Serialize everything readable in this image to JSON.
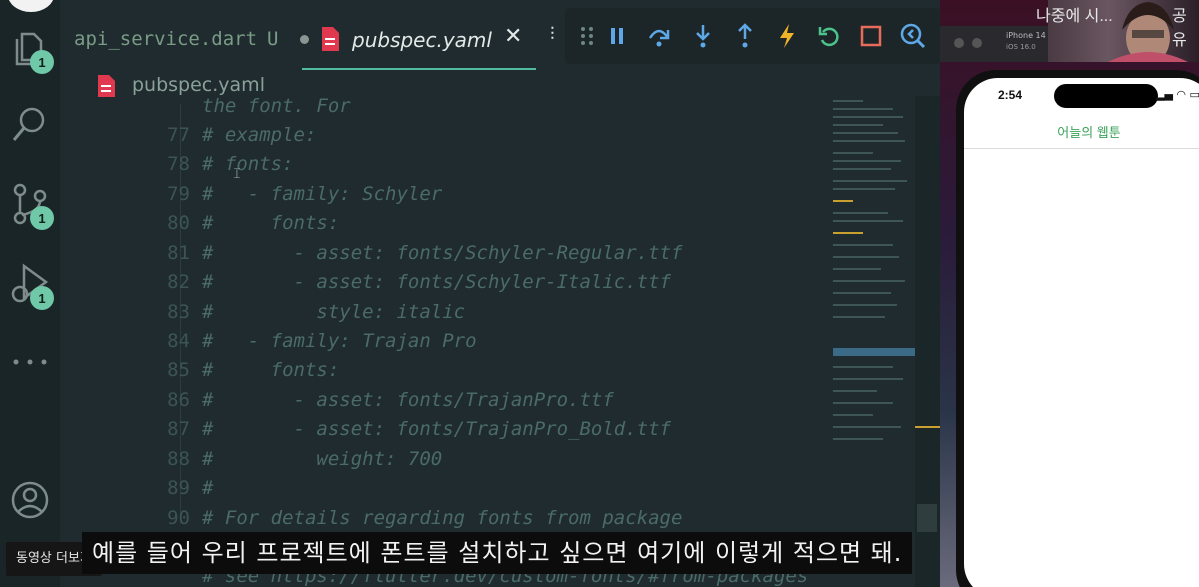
{
  "tabs": [
    {
      "label": "api_service.dart",
      "status": "U"
    },
    {
      "label": "pubspec.yaml"
    }
  ],
  "breadcrumb": "pubspec.yaml",
  "activity_badges": [
    "1",
    "1",
    "1"
  ],
  "code_lines": [
    {
      "num": "",
      "text": "the font. For"
    },
    {
      "num": "77",
      "text": "# example:"
    },
    {
      "num": "78",
      "text": "# fonts:"
    },
    {
      "num": "79",
      "text": "#   - family: Schyler"
    },
    {
      "num": "80",
      "text": "#     fonts:"
    },
    {
      "num": "81",
      "text": "#       - asset: fonts/Schyler-Regular.ttf"
    },
    {
      "num": "82",
      "text": "#       - asset: fonts/Schyler-Italic.ttf"
    },
    {
      "num": "83",
      "text": "#         style: italic"
    },
    {
      "num": "84",
      "text": "#   - family: Trajan Pro"
    },
    {
      "num": "85",
      "text": "#     fonts:"
    },
    {
      "num": "86",
      "text": "#       - asset: fonts/TrajanPro.ttf"
    },
    {
      "num": "87",
      "text": "#       - asset: fonts/TrajanPro_Bold.ttf"
    },
    {
      "num": "88",
      "text": "#         weight: 700"
    },
    {
      "num": "89",
      "text": "#"
    },
    {
      "num": "90",
      "text": "# For details regarding fonts from package"
    },
    {
      "num": "",
      "text": ""
    },
    {
      "num": "",
      "text": "# see https://flutter.dev/custom-fonts/#from-packages"
    }
  ],
  "simulator": {
    "device": "iPhone 14",
    "os": "iOS 16.0",
    "time": "2:54",
    "app_title": "어늘의 웹툰"
  },
  "video": {
    "cam_text_left": "나중에 시...",
    "cam_text_right": "공유",
    "subtitle": "예를 들어 우리 프로젝트에 폰트를 설치하고 싶으면 여기에 이렇게 적으면 돼.",
    "more_videos": "동영상 더보기"
  },
  "colors": {
    "editor_bg": "#1f2b2e",
    "accent": "#4fbca0",
    "badge": "#6fc8a8",
    "comment": "#4b6b68",
    "yaml_icon": "#e0384f"
  }
}
